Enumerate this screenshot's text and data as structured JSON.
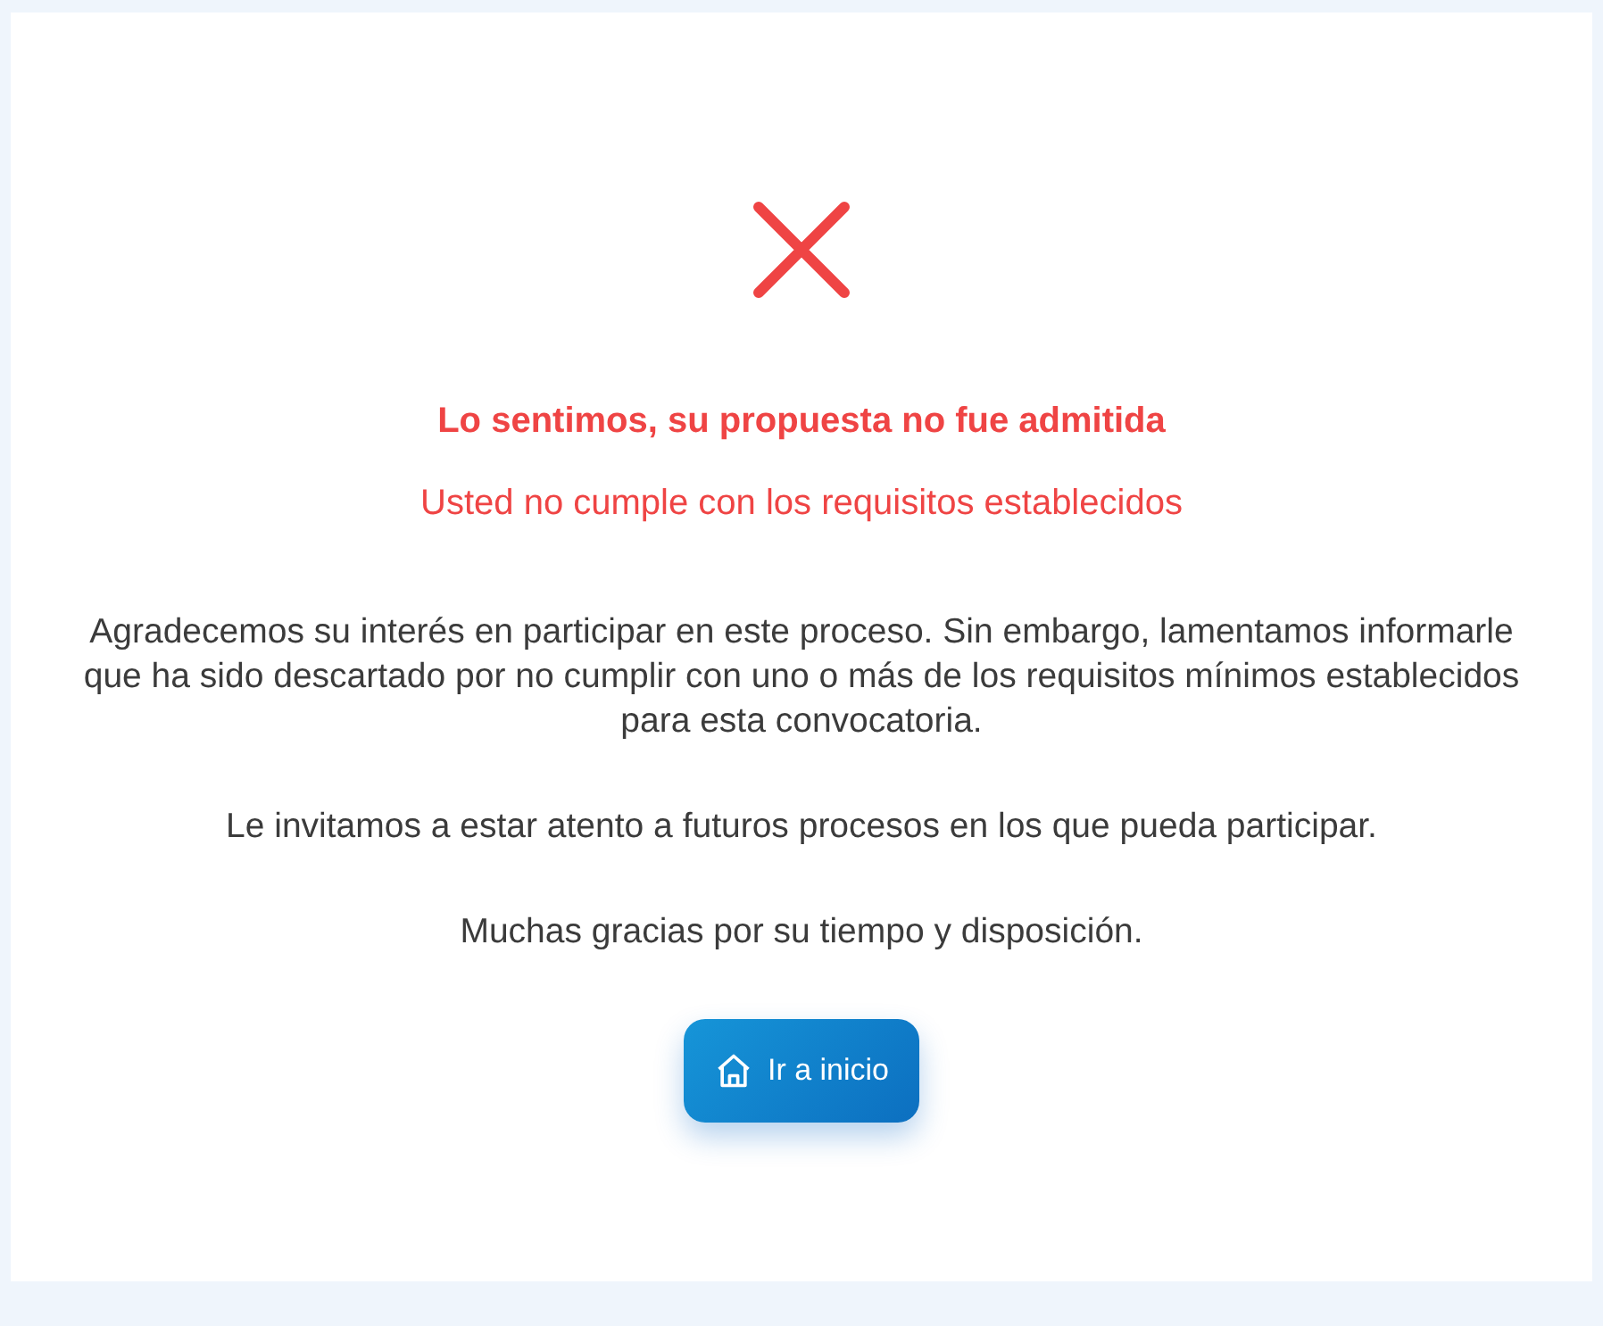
{
  "title": "Lo sentimos, su propuesta no fue admitida",
  "subtitle": "Usted no cumple con los requisitos establecidos",
  "paragraphs": [
    "Agradecemos su interés en participar en este proceso. Sin embargo, lamentamos informarle que ha sido descartado por no cumplir con uno o más de los requisitos mínimos establecidos para esta convocatoria.",
    "Le invitamos a estar atento a futuros procesos en los que pueda participar.",
    "Muchas gracias por su tiempo y disposición."
  ],
  "button": {
    "label": "Ir a inicio"
  }
}
